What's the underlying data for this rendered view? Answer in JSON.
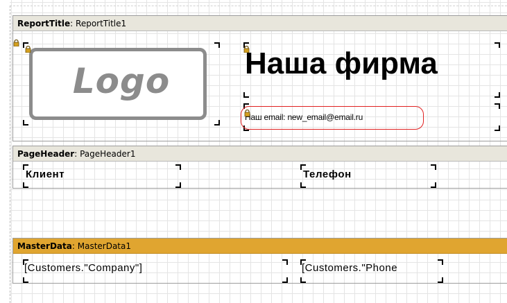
{
  "bands": {
    "report_title": {
      "type": "ReportTitle",
      "name": "ReportTitle1"
    },
    "page_header": {
      "type": "PageHeader",
      "name": "PageHeader1"
    },
    "master_data": {
      "type": "MasterData",
      "name": "MasterData1"
    }
  },
  "logo": {
    "text": "Logo"
  },
  "company_name": "Наша фирма",
  "email_text": "Наш email: new_email@email.ru",
  "page_header_fields": {
    "client": "Клиент",
    "phone": "Телефон"
  },
  "master_fields": {
    "company": "[Customers.\"Company\"]",
    "phone": "[Customers.\"Phone"
  },
  "separators": {
    "type_name": ": "
  },
  "colors": {
    "band_header_gray": "#e8e6dc",
    "band_header_orange": "#e0a530",
    "email_highlight": "#e02020",
    "lock_icon": "#d4a020"
  }
}
